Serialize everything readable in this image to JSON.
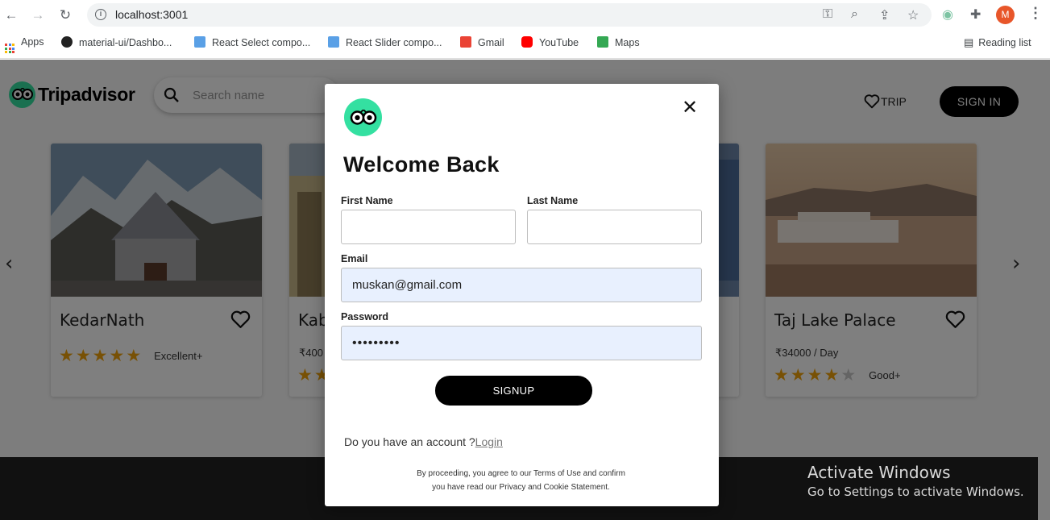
{
  "browser": {
    "url": "localhost:3001",
    "profile_initial": "M",
    "bookmarks": [
      {
        "label": "Apps",
        "icon": "apps-grid-icon"
      },
      {
        "label": "material-ui/Dashbo...",
        "icon": "github-icon"
      },
      {
        "label": "React Select compo...",
        "icon": "react-icon"
      },
      {
        "label": "React Slider compo...",
        "icon": "react-icon"
      },
      {
        "label": "Gmail",
        "icon": "gmail-icon"
      },
      {
        "label": "YouTube",
        "icon": "youtube-icon"
      },
      {
        "label": "Maps",
        "icon": "maps-icon"
      }
    ],
    "reading_list": "Reading list"
  },
  "header": {
    "logo_text": "Tripadvisor",
    "search_placeholder": "Search name",
    "trip_label": "TRIP",
    "signin_label": "SIGN IN"
  },
  "cards": [
    {
      "title": "KedarNath",
      "price": "",
      "stars": 5,
      "rating_label": "Excellent+"
    },
    {
      "title": "Kab",
      "price": "₹400",
      "stars": 2,
      "rating_label": ""
    },
    {
      "title": "Taj Lake Palace",
      "price": "₹34000 / Day",
      "stars": 4,
      "rating_label": "Good+"
    }
  ],
  "modal": {
    "title": "Welcome Back",
    "first_name_label": "First Name",
    "first_name_value": "",
    "last_name_label": "Last Name",
    "last_name_value": "",
    "email_label": "Email",
    "email_value": "muskan@gmail.com",
    "password_label": "Password",
    "password_value": "•••••••••",
    "signup_label": "SIGNUP",
    "account_prompt": "Do you have an account ?",
    "login_link": "Login",
    "terms_line1": "By proceeding, you agree to our Terms of Use and confirm",
    "terms_line2": "you have read our Privacy and Cookie Statement."
  },
  "watermark": {
    "line1": "Activate Windows",
    "line2": "Go to Settings to activate Windows."
  },
  "colors": {
    "brand_green": "#34e0a1",
    "star_gold": "#f0a30a",
    "button_black": "#000000",
    "autofill_blue": "#e8f0fe"
  }
}
